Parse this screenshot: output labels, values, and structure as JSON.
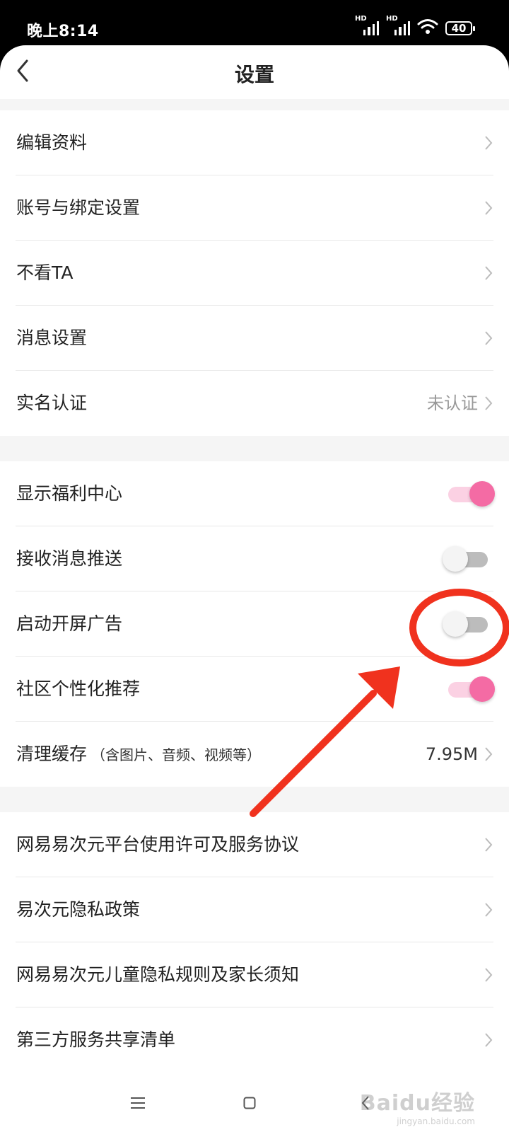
{
  "status_bar": {
    "time": "晚上8:14",
    "signal_label": "HD",
    "battery": "40"
  },
  "header": {
    "title": "设置"
  },
  "section1": [
    {
      "label": "编辑资料"
    },
    {
      "label": "账号与绑定设置"
    },
    {
      "label": "不看TA"
    },
    {
      "label": "消息设置"
    },
    {
      "label": "实名认证",
      "value": "未认证"
    }
  ],
  "section2": [
    {
      "label": "显示福利中心",
      "toggle": "on"
    },
    {
      "label": "接收消息推送",
      "toggle": "off"
    },
    {
      "label": "启动开屏广告",
      "toggle": "off"
    },
    {
      "label": "社区个性化推荐",
      "toggle": "on"
    },
    {
      "label": "清理缓存",
      "sublabel": "（含图片、音频、视频等）",
      "value": "7.95M"
    }
  ],
  "section3": [
    {
      "label": "网易易次元平台使用许可及服务协议"
    },
    {
      "label": "易次元隐私政策"
    },
    {
      "label": "网易易次元儿童隐私规则及家长须知"
    },
    {
      "label": "第三方服务共享清单"
    }
  ],
  "watermark": {
    "brand": "Baidu经验",
    "url": "jingyan.baidu.com"
  },
  "colors": {
    "toggle_on": "#f46ba4",
    "toggle_on_track": "#fbd1e3",
    "toggle_off_track": "#bcbcbc",
    "annotation": "#f0321e",
    "section_gap": "#f5f5f5"
  }
}
